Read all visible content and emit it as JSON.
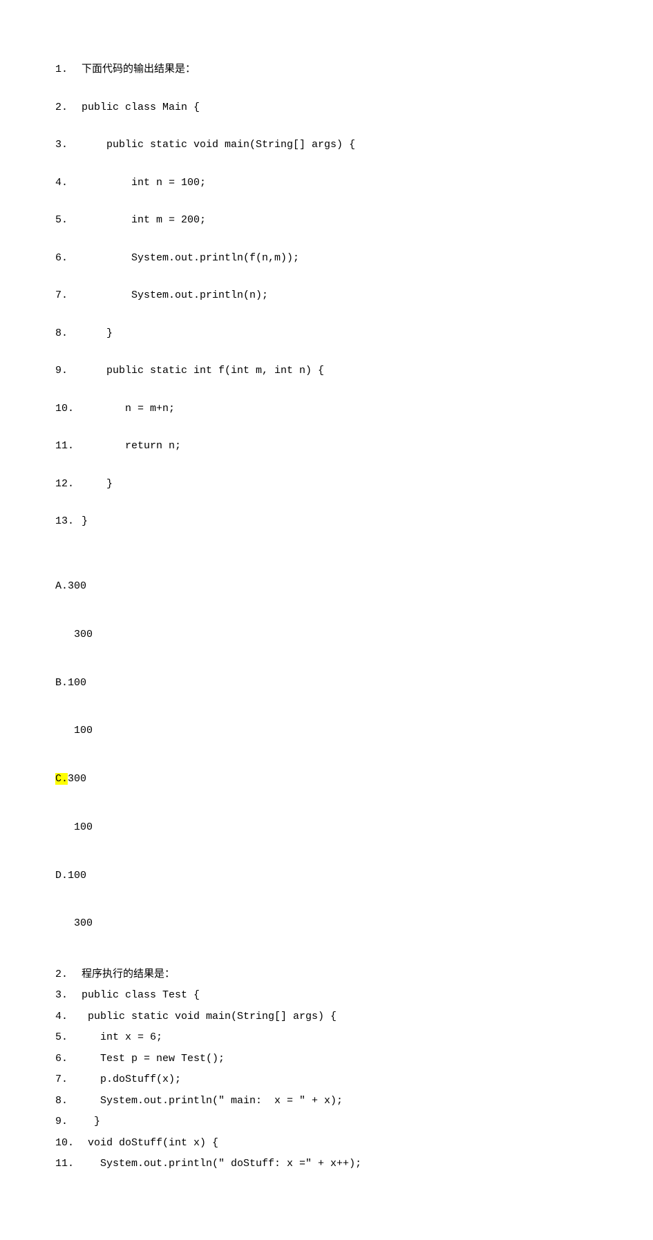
{
  "block1": {
    "lines": [
      {
        "n": "1.",
        "t": "下面代码的输出结果是："
      },
      {
        "n": "2.",
        "t": "public class Main {"
      },
      {
        "n": "3.",
        "t": "    public static void main(String[] args) {"
      },
      {
        "n": "4.",
        "t": "        int n = 100;"
      },
      {
        "n": "5.",
        "t": "        int m = 200;"
      },
      {
        "n": "6.",
        "t": "        System.out.println(f(n,m));"
      },
      {
        "n": "7.",
        "t": "        System.out.println(n);"
      },
      {
        "n": "8.",
        "t": "    }"
      },
      {
        "n": "9.",
        "t": "    public static int f(int m, int n) {"
      },
      {
        "n": "10.",
        "t": "       n = m+n;"
      },
      {
        "n": "11.",
        "t": "       return n;"
      },
      {
        "n": "12.",
        "t": "    }"
      },
      {
        "n": "13.",
        "t": "}"
      }
    ]
  },
  "options1": {
    "A": {
      "label": "A.",
      "l1": "300",
      "l2": "   300"
    },
    "B": {
      "label": "B.",
      "l1": "100",
      "l2": "   100"
    },
    "C": {
      "label": "C.",
      "l1": "300",
      "l2": "   100",
      "highlight": true
    },
    "D": {
      "label": "D.",
      "l1": "100",
      "l2": "   300"
    }
  },
  "block2": {
    "lines": [
      {
        "n": "2.",
        "t": "程序执行的结果是："
      },
      {
        "n": "3.",
        "t": "public class Test {"
      },
      {
        "n": "4.",
        "t": " public static void main(String[] args) {"
      },
      {
        "n": "5.",
        "t": "   int x = 6;"
      },
      {
        "n": "6.",
        "t": "   Test p = new Test();"
      },
      {
        "n": "7.",
        "t": "   p.doStuff(x);"
      },
      {
        "n": "8.",
        "t": "   System.out.println(\" main:  x = \" + x);"
      },
      {
        "n": "9.",
        "t": "  }"
      },
      {
        "n": "10.",
        "t": " void doStuff(int x) {"
      },
      {
        "n": "11.",
        "t": "   System.out.println(\" doStuff: x =\" + x++);"
      }
    ]
  }
}
